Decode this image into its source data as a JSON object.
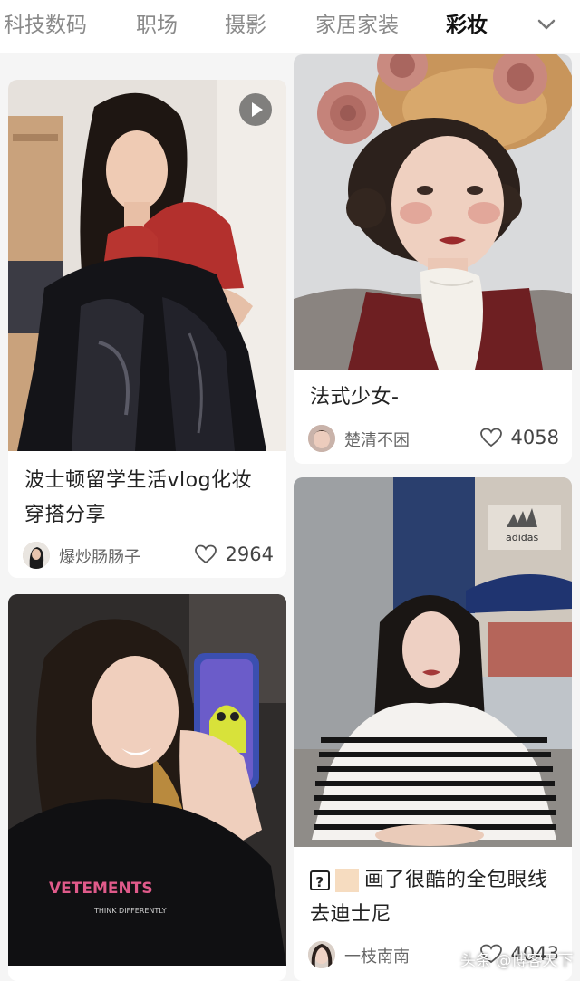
{
  "tabs": [
    {
      "label": "科技数码",
      "active": false
    },
    {
      "label": "职场",
      "active": false
    },
    {
      "label": "摄影",
      "active": false
    },
    {
      "label": "家居家装",
      "active": false
    },
    {
      "label": "彩妆",
      "active": true
    }
  ],
  "more_icon": "chevron-down-icon",
  "cards": [
    {
      "title": "波士顿留学生活vlog化妆穿搭分享",
      "author": "爆炒肠肠子",
      "likes": "2964",
      "has_video": true
    },
    {
      "title": "法式少女-",
      "author": "楚清不困",
      "likes": "4058",
      "has_video": false
    },
    {
      "title_prefix_icon": "question-box-icon",
      "title": "画了很酷的全包眼线去迪士尼",
      "author": "一枝南南",
      "likes": "4043",
      "has_video": false
    },
    {
      "title": "",
      "author": "",
      "likes": "",
      "has_video": false
    }
  ],
  "image_texts": {
    "shirt_print": "VETEMENTS",
    "shirt_sub": "THINK DIFFERENTLY",
    "store_sign": "adidas"
  },
  "watermark": "头条 @博客天下",
  "colors": {
    "active_tab": "#111111",
    "inactive_tab": "#8a8a8a",
    "card_bg": "#ffffff",
    "page_bg": "#f5f5f5"
  }
}
